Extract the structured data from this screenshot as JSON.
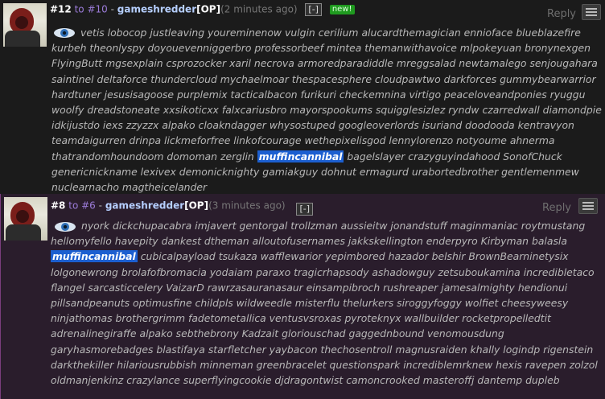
{
  "posts": [
    {
      "number": "#12",
      "to_label": "to",
      "to_number": "#10",
      "separator": "-",
      "username": "gameshredder",
      "op_tag": "[OP]",
      "timestamp": "(2 minutes ago)",
      "collapse_label": "[-]",
      "new_badge": "new!",
      "reply_label": "Reply",
      "watchers_before": "vetis lobocop justleaving youreminenow vulgin cerilium alucardthemagician ennioface blueblazefire kurbeh theonlyspy doyouevenniggerbro professorbeef mintea themanwithavoice mlpokeyuan bronynexgen FlyingButt mgsexplain csprozocker xaril necrova armoredparadiddle mreggsalad newtamalego senjougahara saintinel deltaforce thundercloud mychaelmoar thespacesphere cloudpawtwo darkforces gummybearwarrior hardtuner jesusisagoose purplemix tacticalbacon furikuri checkemnina virtigo peaceloveandponies ryuggu woolfy dreadstoneate xxsikoticxx falxcariusbro mayorspookums squigglesizlez ryndw czarredwall diamondpie idkijustdo iexs zzyzzx alpako cloakndagger whysostuped googleoverlords isuriand doodooda kentravyon teamdaigurren drinpa lickmeforfree linkofcourage wethepixelisgod lennylorenzo notyoume ahnerma thatrandomhoundoom domoman zerglin",
      "highlighted": "muffincannibal",
      "watchers_after": "bagelslayer crazyguyindahood SonofChuck genericnickname lexivex demonicknighty gamiakguy dohnut ermagurd urabortedbrother gentlemenmew nuclearnacho magtheicelander"
    },
    {
      "number": "#8",
      "to_label": "to",
      "to_number": "#6",
      "separator": "-",
      "username": "gameshredder",
      "op_tag": "[OP]",
      "timestamp": "(3 minutes ago)",
      "collapse_label": "[-]",
      "reply_label": "Reply",
      "watchers_before": "nyork dickchupacabra imjavert gentorgal trollzman aussieitw jonandstuff maginmaniac roytmustang hellomyfello havepity dankest dtheman alloutofusernames jakkskellington enderpyro Kirbyman balasla",
      "highlighted": "muffincannibal",
      "watchers_after": "cubicalpayload tsukaza wafflewarior yepimbored hazador belshir BrownBearninetysix lolgonewrong brolafofbromacia yodaiam paraxo tragicrhapsody ashadowguy zetsuboukamina incredibletaco flangel sarcasticcelery VaizarD rawrzasauranasaur einsampibroch rushreaper jamesalmighty hendionui pillsandpeanuts optimusfine childpls wildweedle misterflu thelurkers siroggyfoggy wolfiet cheesyweesy ninjathomas brothergrimm fadetometallica ventusvsroxas pyroteknyx wallbuilder rocketpropelledtit adrenalinegiraffe alpako sebthebrony Kadzait gloriouschad gaggednbound venomousdung garyhasmorebadges blastifaya starfletcher yaybacon thechosentroll magnusraiden khally logindp rigenstein darkthekiller hilariousrubbish minneman greenbracelet questionspark incrediblemrknew hexis ravepen zolzol oldmanjenkinz crazylance superflyingcookie djdragontwist camoncrooked masteroffj dantemp dupleb"
    }
  ],
  "icons": {
    "eye": "eye-icon",
    "menu": "hamburger-icon",
    "avatar": "avatar"
  },
  "colors": {
    "post1_bg": "#1b1b1b",
    "post2_bg": "#2a1d2c",
    "username": "#b6cfff",
    "reply_link": "#9b7bd8",
    "highlight": "#1c5fd0",
    "new_badge": "#1f9a1f"
  }
}
